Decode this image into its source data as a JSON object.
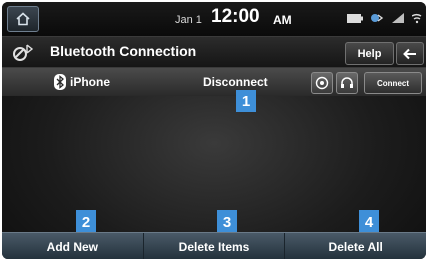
{
  "status_bar": {
    "date": "Jan 1",
    "time": "12:00",
    "ampm": "AM",
    "icons": [
      "battery-icon",
      "bluetooth-phone-icon",
      "signal-icon",
      "wifi-icon"
    ]
  },
  "title_bar": {
    "title": "Bluetooth Connection",
    "help_label": "Help",
    "icons": [
      "bluetooth-phone-icon",
      "back-arrow-icon"
    ]
  },
  "device_row": {
    "device_name": "iPhone",
    "status_action": "Disconnect",
    "connect_label": "Connect",
    "icons": [
      "bluetooth-icon",
      "audio-icon",
      "headset-icon"
    ]
  },
  "bottom_bar": {
    "add_new": "Add New",
    "delete_items": "Delete Items",
    "delete_all": "Delete All"
  },
  "callouts": [
    "1",
    "2",
    "3",
    "4"
  ],
  "colors": {
    "callout": "#3e8fd8",
    "background": "#1c1c1c",
    "bottom_bar": "#34434f"
  }
}
